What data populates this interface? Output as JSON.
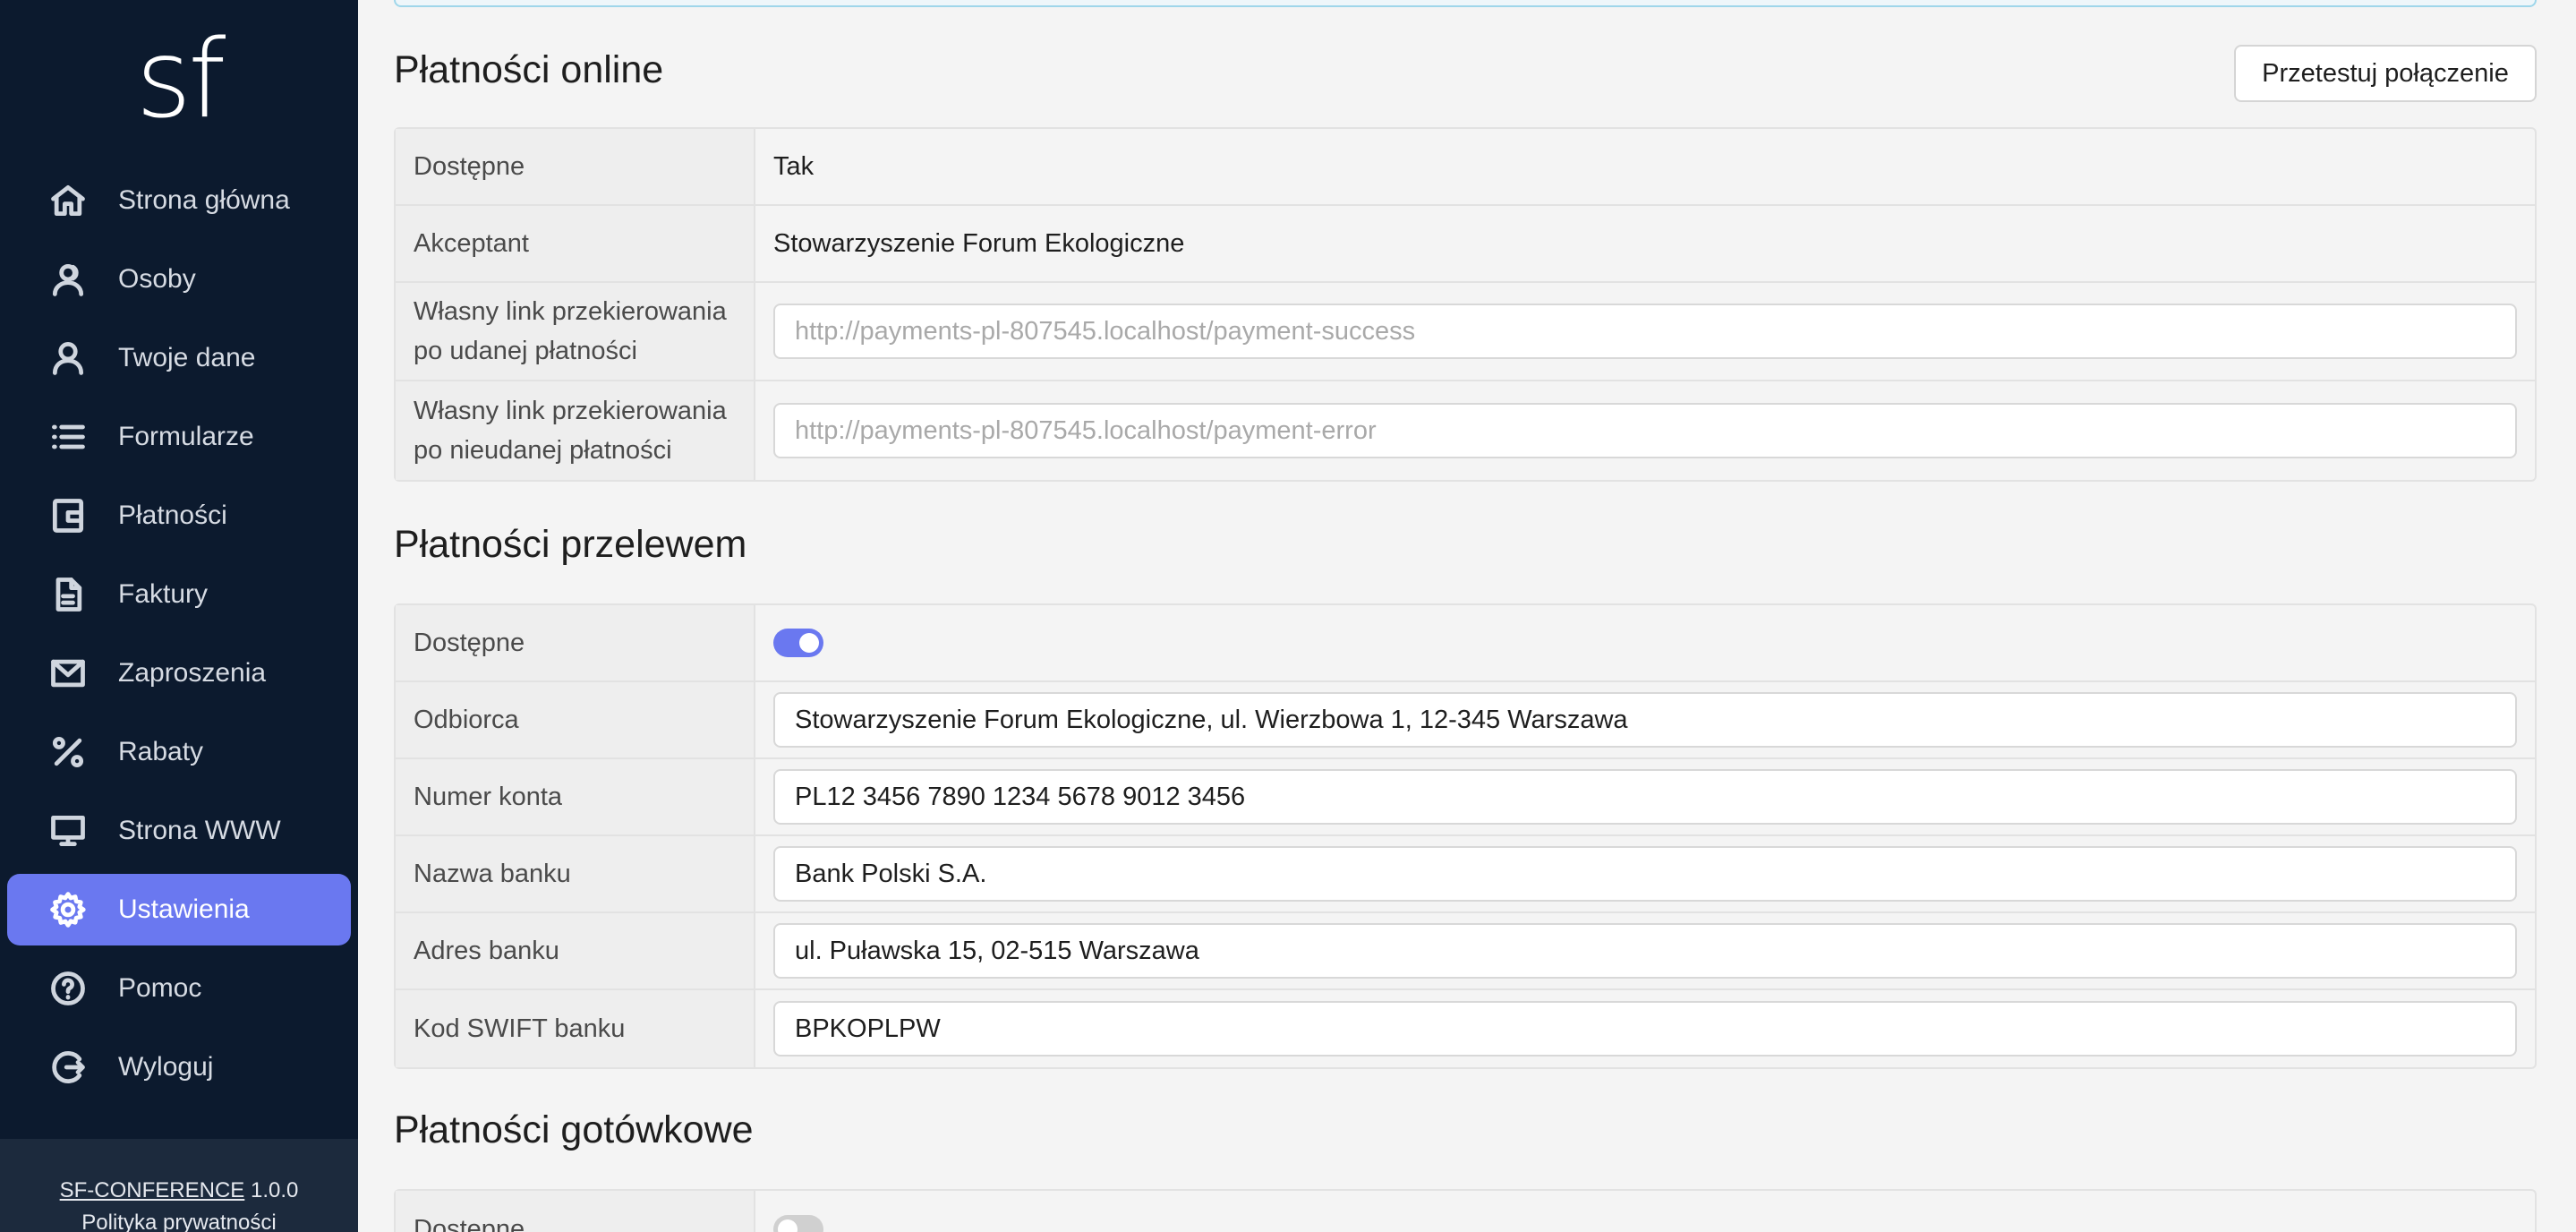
{
  "app": {
    "logo_text": "sf"
  },
  "sidebar": {
    "items": [
      {
        "label": "Strona główna",
        "icon": "home-icon"
      },
      {
        "label": "Osoby",
        "icon": "users-icon"
      },
      {
        "label": "Twoje dane",
        "icon": "user-icon"
      },
      {
        "label": "Formularze",
        "icon": "list-icon"
      },
      {
        "label": "Płatności",
        "icon": "wallet-icon"
      },
      {
        "label": "Faktury",
        "icon": "document-icon"
      },
      {
        "label": "Zaproszenia",
        "icon": "mail-icon"
      },
      {
        "label": "Rabaty",
        "icon": "percent-icon"
      },
      {
        "label": "Strona WWW",
        "icon": "monitor-icon"
      },
      {
        "label": "Ustawienia",
        "icon": "gear-icon",
        "active": true
      },
      {
        "label": "Pomoc",
        "icon": "help-icon"
      },
      {
        "label": "Wyloguj",
        "icon": "logout-icon"
      }
    ],
    "footer": {
      "app_name": "SF-CONFERENCE",
      "version": "1.0.0",
      "privacy_link": "Polityka prywatności"
    },
    "active_color": "#6a78f0",
    "background_color": "#0c1a2e"
  },
  "online": {
    "title": "Płatności online",
    "test_button": "Przetestuj połączenie",
    "rows": {
      "available": {
        "label": "Dostępne",
        "value": "Tak"
      },
      "acceptor": {
        "label": "Akceptant",
        "value": "Stowarzyszenie Forum Ekologiczne"
      },
      "success_link": {
        "label": "Własny link przekierowania po udanej płatności",
        "placeholder": "http://payments-pl-807545.localhost/payment-success"
      },
      "error_link": {
        "label": "Własny link przekierowania po nieudanej płatności",
        "placeholder": "http://payments-pl-807545.localhost/payment-error"
      }
    }
  },
  "transfer": {
    "title": "Płatności przelewem",
    "rows": {
      "available": {
        "label": "Dostępne",
        "enabled": true
      },
      "recipient": {
        "label": "Odbiorca",
        "value": "Stowarzyszenie Forum Ekologiczne, ul. Wierzbowa 1, 12-345 Warszawa"
      },
      "account": {
        "label": "Numer konta",
        "value": "PL12 3456 7890 1234 5678 9012 3456"
      },
      "bank_name": {
        "label": "Nazwa banku",
        "value": "Bank Polski S.A."
      },
      "bank_address": {
        "label": "Adres banku",
        "value": "ul. Puławska 15, 02-515 Warszawa"
      },
      "swift": {
        "label": "Kod SWIFT banku",
        "value": "BPKOPLPW"
      }
    }
  },
  "cash": {
    "title": "Płatności gotówkowe",
    "rows": {
      "available": {
        "label": "Dostępne",
        "enabled": false
      }
    }
  }
}
